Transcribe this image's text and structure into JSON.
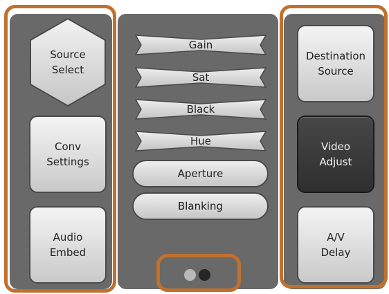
{
  "left_column": {
    "source_select_label": "Source\nSelect",
    "conv_settings_label": "Conv\nSettings",
    "audio_embed_label": "Audio\nEmbed"
  },
  "adjust_menu": {
    "items": [
      {
        "label": "Gain",
        "shape": "bowtie"
      },
      {
        "label": "Sat",
        "shape": "bowtie"
      },
      {
        "label": "Black",
        "shape": "bowtie"
      },
      {
        "label": "Hue",
        "shape": "bowtie"
      },
      {
        "label": "Aperture",
        "shape": "pill"
      },
      {
        "label": "Blanking",
        "shape": "pill"
      }
    ]
  },
  "pager": {
    "pages": 2,
    "current_page": 2
  },
  "right_column": {
    "destination_source_label": "Destination\nSource",
    "video_adjust_label": "Video\nAdjust",
    "av_delay_label": "A/V\nDelay"
  },
  "colors": {
    "highlight": "#c0702f",
    "panel": "#696969",
    "active_button": "#3a3a3a"
  }
}
